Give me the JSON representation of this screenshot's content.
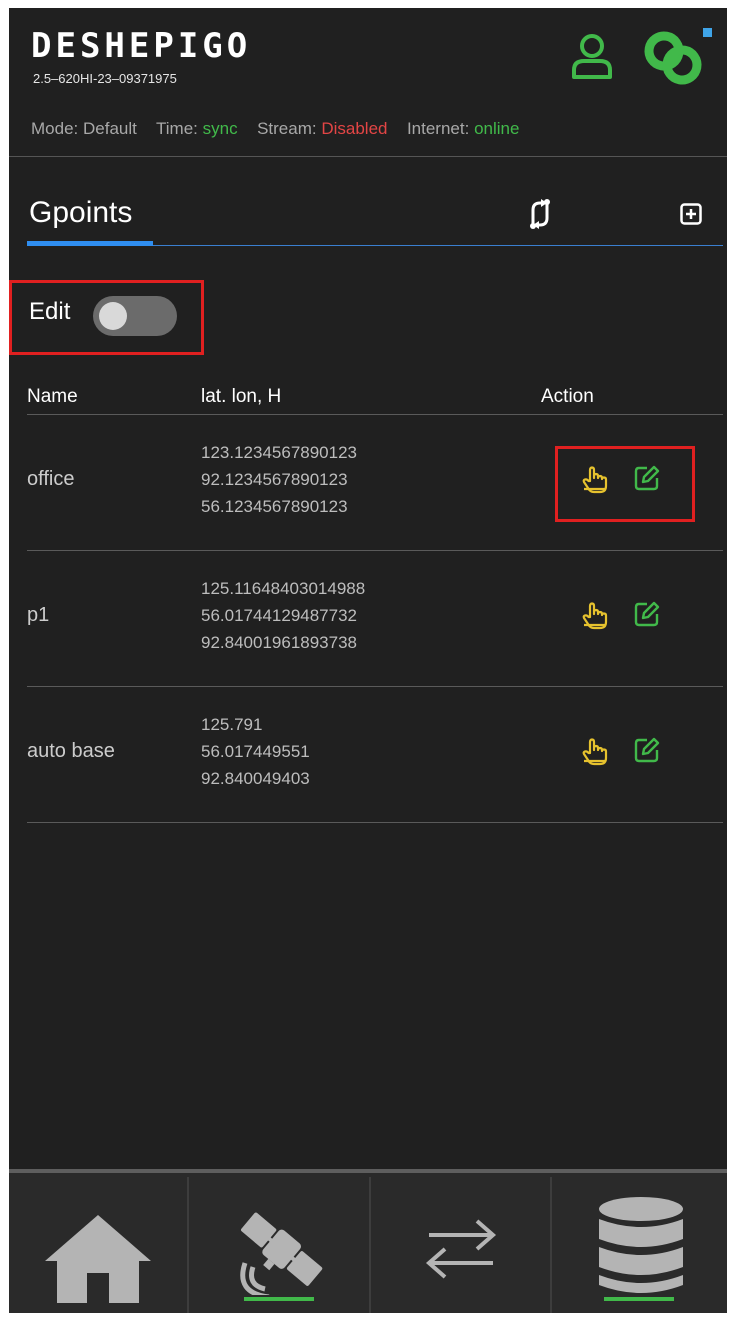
{
  "header": {
    "brand": "DESHEPIGO",
    "serial": "2.5–620HI-23–09371975",
    "status": {
      "mode_label": "Mode:",
      "mode_value": "Default",
      "time_label": "Time:",
      "time_value": "sync",
      "stream_label": "Stream:",
      "stream_value": "Disabled",
      "internet_label": "Internet:",
      "internet_value": "online"
    },
    "icons": [
      "user-icon",
      "connection-link-icon"
    ]
  },
  "section": {
    "title": "Gpoints",
    "icons": [
      "sync-icon",
      "add-icon"
    ]
  },
  "edit_toggle": {
    "label": "Edit",
    "on": false
  },
  "table": {
    "headers": [
      "Name",
      "lat. lon, H",
      "Action"
    ],
    "rows": [
      {
        "name": "office",
        "lat": "123.1234567890123",
        "lon": "92.1234567890123",
        "h": "56.1234567890123"
      },
      {
        "name": "p1",
        "lat": "125.11648403014988",
        "lon": "56.01744129487732",
        "h": "92.84001961893738"
      },
      {
        "name": "auto base",
        "lat": "125.791",
        "lon": "56.017449551",
        "h": "92.840049403"
      }
    ],
    "action_icons": [
      "hand-pointer-icon",
      "edit-icon"
    ]
  },
  "bottom_nav": [
    {
      "name": "home",
      "icon": "home-icon",
      "active": false
    },
    {
      "name": "satellite",
      "icon": "satellite-icon",
      "active": true
    },
    {
      "name": "transfer",
      "icon": "transfer-arrows-icon",
      "active": false
    },
    {
      "name": "database",
      "icon": "database-icon",
      "active": true
    }
  ],
  "colors": {
    "background": "#202020",
    "accent_green": "#41b94a",
    "accent_red": "#e34545",
    "accent_blue": "#2f8ef0",
    "action_yellow": "#e6c22e",
    "highlight_red": "#e02020"
  }
}
